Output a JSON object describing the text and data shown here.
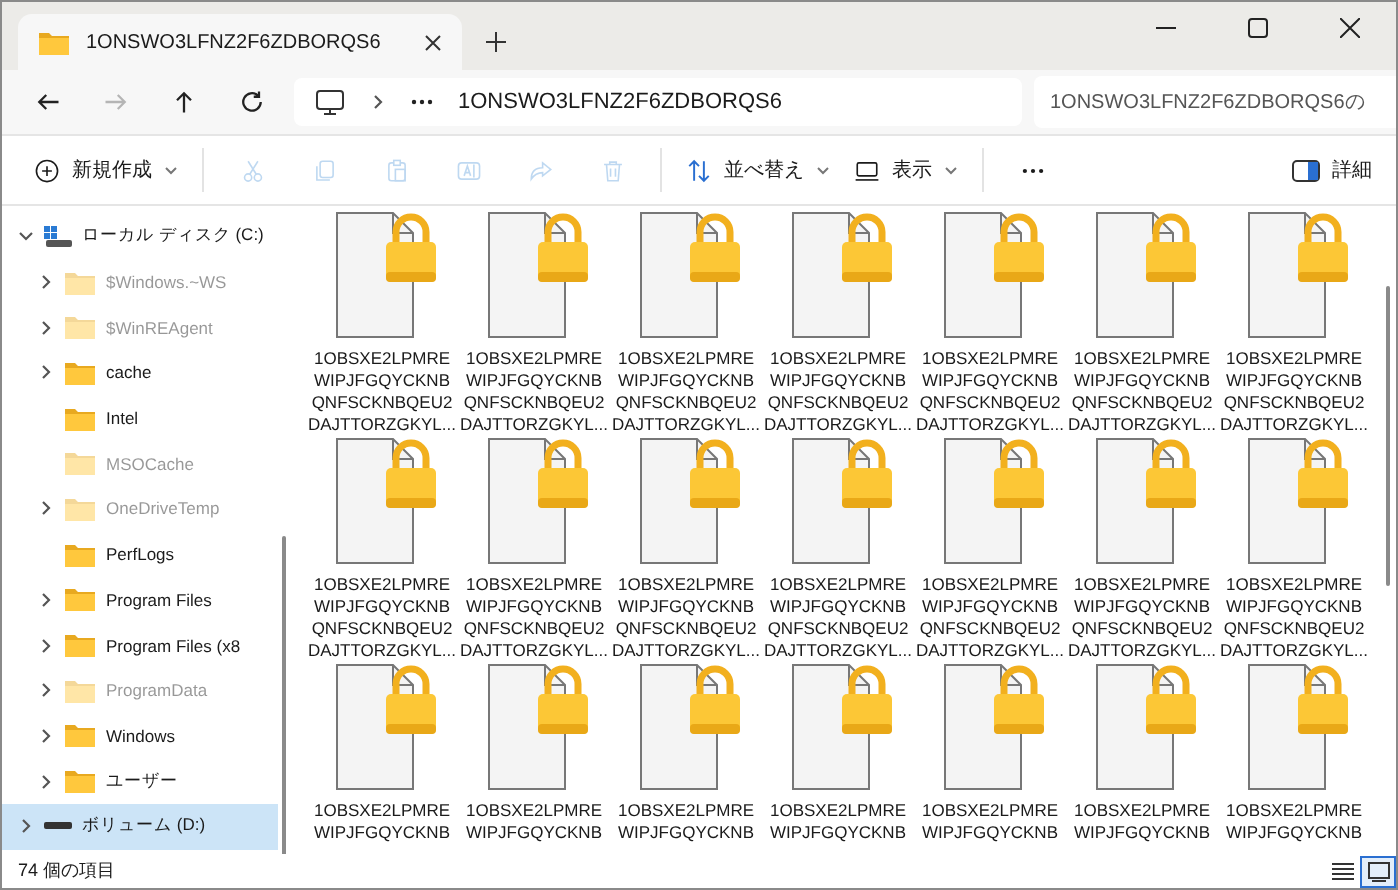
{
  "tab": {
    "title": "1ONSWO3LFNZ2F6ZDBORQS6",
    "selected": true
  },
  "nav": [
    {
      "kind": "back",
      "disabled": false
    },
    {
      "kind": "forward",
      "disabled": true
    },
    {
      "kind": "up",
      "disabled": false
    },
    {
      "kind": "refresh",
      "disabled": false
    }
  ],
  "address": {
    "crumb": "1ONSWO3LFNZ2F6ZDBORQS6"
  },
  "search": {
    "placeholder": "1ONSWO3LFNZ2F6ZDBORQS6の"
  },
  "toolbar": [
    {
      "kind": "new",
      "label": "新規作成",
      "disabled": false
    },
    {
      "kind": "cut",
      "disabled": true
    },
    {
      "kind": "copy",
      "disabled": true
    },
    {
      "kind": "paste",
      "disabled": true
    },
    {
      "kind": "rename",
      "disabled": true
    },
    {
      "kind": "share",
      "disabled": true
    },
    {
      "kind": "delete",
      "disabled": true
    },
    {
      "kind": "sort",
      "label": "並べ替え",
      "disabled": false
    },
    {
      "kind": "view",
      "label": "表示",
      "disabled": false
    },
    {
      "kind": "more",
      "disabled": false
    }
  ],
  "details_button": {
    "label": "詳細"
  },
  "sidebar": {
    "drive": {
      "label": "ローカル ディスク (C:)",
      "expanded": true,
      "children": [
        {
          "label": "$Windows.~WS",
          "hidden": true,
          "has_children": true
        },
        {
          "label": "$WinREAgent",
          "hidden": true,
          "has_children": true
        },
        {
          "label": "cache",
          "hidden": false,
          "has_children": true
        },
        {
          "label": "Intel",
          "hidden": false,
          "has_children": false
        },
        {
          "label": "MSOCache",
          "hidden": true,
          "has_children": false
        },
        {
          "label": "OneDriveTemp",
          "hidden": true,
          "has_children": true
        },
        {
          "label": "PerfLogs",
          "hidden": false,
          "has_children": false
        },
        {
          "label": "Program Files",
          "hidden": false,
          "has_children": true
        },
        {
          "label": "Program Files (x8",
          "hidden": false,
          "has_children": true
        },
        {
          "label": "ProgramData",
          "hidden": true,
          "has_children": true
        },
        {
          "label": "Windows",
          "hidden": false,
          "has_children": true
        },
        {
          "label": "ユーザー",
          "hidden": false,
          "has_children": true
        }
      ]
    },
    "volume": {
      "label": "ボリューム (D:)",
      "selected": true,
      "expanded": false
    }
  },
  "files": [
    {
      "lines": [
        "1OBSXE2LPMRE",
        "WIPJFGQYCKNB",
        "QNFSCKNBQEU2",
        "DAJTTORZGKYL..."
      ]
    },
    {
      "lines": [
        "1OBSXE2LPMRE",
        "WIPJFGQYCKNB",
        "QNFSCKNBQEU2",
        "DAJTTORZGKYL..."
      ]
    },
    {
      "lines": [
        "1OBSXE2LPMRE",
        "WIPJFGQYCKNB",
        "QNFSCKNBQEU2",
        "DAJTTORZGKYL..."
      ]
    },
    {
      "lines": [
        "1OBSXE2LPMRE",
        "WIPJFGQYCKNB",
        "QNFSCKNBQEU2",
        "DAJTTORZGKYL..."
      ]
    },
    {
      "lines": [
        "1OBSXE2LPMRE",
        "WIPJFGQYCKNB",
        "QNFSCKNBQEU2",
        "DAJTTORZGKYL..."
      ]
    },
    {
      "lines": [
        "1OBSXE2LPMRE",
        "WIPJFGQYCKNB",
        "QNFSCKNBQEU2",
        "DAJTTORZGKYL..."
      ]
    },
    {
      "lines": [
        "1OBSXE2LPMRE",
        "WIPJFGQYCKNB",
        "QNFSCKNBQEU2",
        "DAJTTORZGKYL..."
      ]
    },
    {
      "lines": [
        "1OBSXE2LPMRE",
        "WIPJFGQYCKNB",
        "QNFSCKNBQEU2",
        "DAJTTORZGKYL..."
      ]
    },
    {
      "lines": [
        "1OBSXE2LPMRE",
        "WIPJFGQYCKNB",
        "QNFSCKNBQEU2",
        "DAJTTORZGKYL..."
      ]
    },
    {
      "lines": [
        "1OBSXE2LPMRE",
        "WIPJFGQYCKNB",
        "QNFSCKNBQEU2",
        "DAJTTORZGKYL..."
      ]
    },
    {
      "lines": [
        "1OBSXE2LPMRE",
        "WIPJFGQYCKNB",
        "QNFSCKNBQEU2",
        "DAJTTORZGKYL..."
      ]
    },
    {
      "lines": [
        "1OBSXE2LPMRE",
        "WIPJFGQYCKNB",
        "QNFSCKNBQEU2",
        "DAJTTORZGKYL..."
      ]
    },
    {
      "lines": [
        "1OBSXE2LPMRE",
        "WIPJFGQYCKNB",
        "QNFSCKNBQEU2",
        "DAJTTORZGKYL..."
      ]
    },
    {
      "lines": [
        "1OBSXE2LPMRE",
        "WIPJFGQYCKNB",
        "QNFSCKNBQEU2",
        "DAJTTORZGKYL..."
      ]
    },
    {
      "lines": [
        "1OBSXE2LPMRE",
        "WIPJFGQYCKNB"
      ]
    },
    {
      "lines": [
        "1OBSXE2LPMRE",
        "WIPJFGQYCKNB"
      ]
    },
    {
      "lines": [
        "1OBSXE2LPMRE",
        "WIPJFGQYCKNB"
      ]
    },
    {
      "lines": [
        "1OBSXE2LPMRE",
        "WIPJFGQYCKNB"
      ]
    },
    {
      "lines": [
        "1OBSXE2LPMRE",
        "WIPJFGQYCKNB"
      ]
    },
    {
      "lines": [
        "1OBSXE2LPMRE",
        "WIPJFGQYCKNB"
      ]
    },
    {
      "lines": [
        "1OBSXE2LPMRE",
        "WIPJFGQYCKNB"
      ]
    }
  ],
  "status_bar": {
    "count": "74 個の項目",
    "views": [
      {
        "kind": "details",
        "selected": false
      },
      {
        "kind": "icons",
        "selected": true
      }
    ]
  }
}
